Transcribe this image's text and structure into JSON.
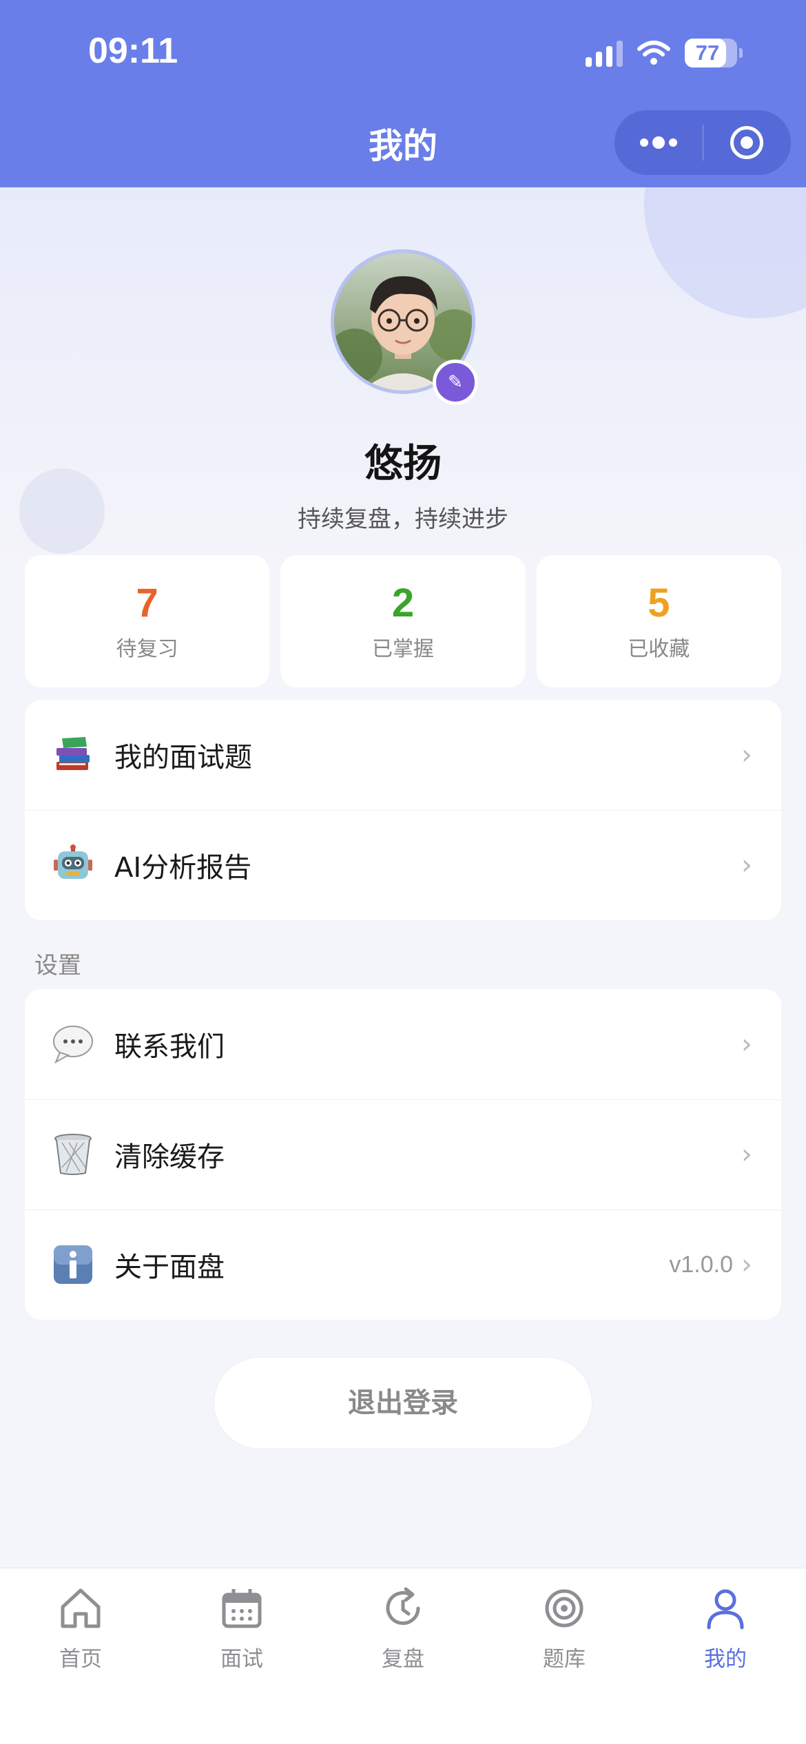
{
  "status_bar": {
    "time": "09:11",
    "battery": "77"
  },
  "header": {
    "title": "我的"
  },
  "profile": {
    "name": "悠扬",
    "motto": "持续复盘，持续进步"
  },
  "stats": [
    {
      "value": "7",
      "label": "待复习",
      "color": "#e8632a"
    },
    {
      "value": "2",
      "label": "已掌握",
      "color": "#3aa52a"
    },
    {
      "value": "5",
      "label": "已收藏",
      "color": "#f0a020"
    }
  ],
  "menu_main": [
    {
      "label": "我的面试题",
      "icon": "books-icon"
    },
    {
      "label": "AI分析报告",
      "icon": "robot-icon"
    }
  ],
  "settings": {
    "section_label": "设置",
    "items": [
      {
        "label": "联系我们",
        "icon": "speech-bubble-icon"
      },
      {
        "label": "清除缓存",
        "icon": "trash-icon"
      },
      {
        "label": "关于面盘",
        "icon": "info-icon",
        "meta": "v1.0.0"
      }
    ]
  },
  "logout_label": "退出登录",
  "tabbar": [
    {
      "label": "首页",
      "icon": "home-icon"
    },
    {
      "label": "面试",
      "icon": "calendar-icon"
    },
    {
      "label": "复盘",
      "icon": "history-icon"
    },
    {
      "label": "题库",
      "icon": "target-icon"
    },
    {
      "label": "我的",
      "icon": "user-icon",
      "active": true
    }
  ],
  "colors": {
    "header": "#6a7ee9",
    "accent": "#5a6fe0",
    "background": "#f4f5fa"
  }
}
